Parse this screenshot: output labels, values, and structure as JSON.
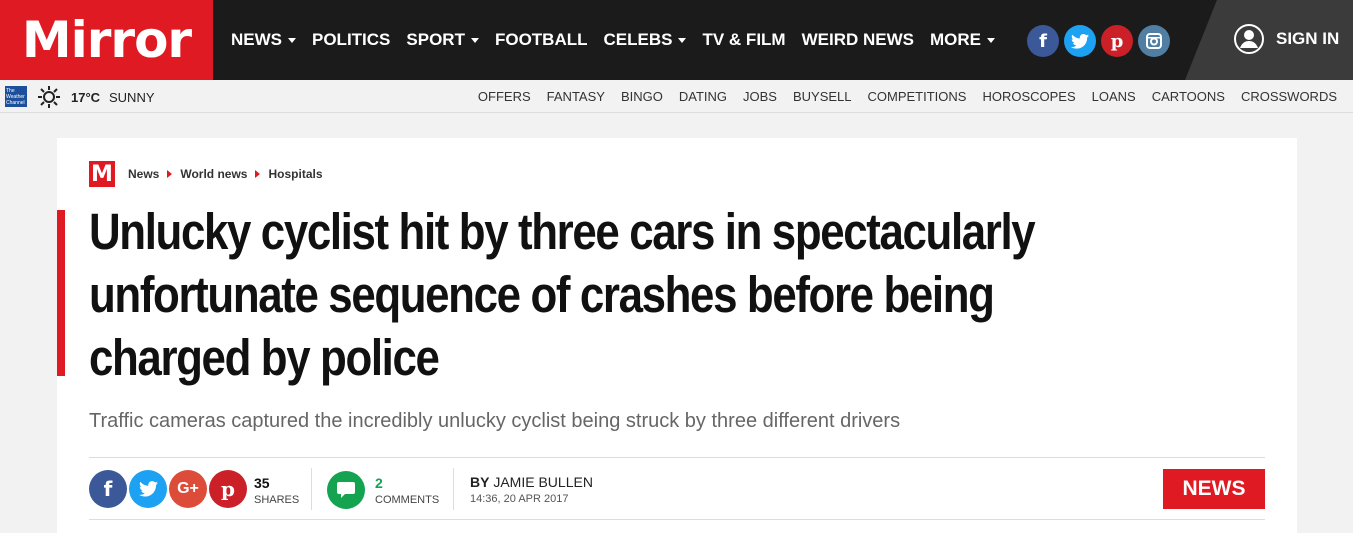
{
  "brand": {
    "logo_text": "Mirror"
  },
  "nav": {
    "items": [
      {
        "label": "NEWS",
        "dropdown": true
      },
      {
        "label": "POLITICS",
        "dropdown": false
      },
      {
        "label": "SPORT",
        "dropdown": true
      },
      {
        "label": "FOOTBALL",
        "dropdown": false
      },
      {
        "label": "CELEBS",
        "dropdown": true
      },
      {
        "label": "TV & FILM",
        "dropdown": false
      },
      {
        "label": "WEIRD NEWS",
        "dropdown": false
      },
      {
        "label": "MORE",
        "dropdown": true
      }
    ],
    "social": [
      {
        "icon": "facebook-icon",
        "glyph": "f",
        "color": "#3b5998"
      },
      {
        "icon": "twitter-icon",
        "glyph": "t",
        "color": "#1da1f2"
      },
      {
        "icon": "pinterest-icon",
        "glyph": "p",
        "color": "#cb2027"
      },
      {
        "icon": "instagram-icon",
        "glyph": "◘",
        "color": "#517fa4"
      }
    ],
    "sign_in": "SIGN IN"
  },
  "weather": {
    "provider_logo_text": "The Weather Channel",
    "temperature": "17°C",
    "condition": "SUNNY"
  },
  "sub_links": [
    "OFFERS",
    "FANTASY",
    "BINGO",
    "DATING",
    "JOBS",
    "BUYSELL",
    "COMPETITIONS",
    "HOROSCOPES",
    "LOANS",
    "CARTOONS",
    "CROSSWORDS"
  ],
  "article": {
    "breadcrumb_logo": "M",
    "breadcrumb": [
      "News",
      "World news",
      "Hospitals"
    ],
    "headline": "Unlucky cyclist hit by three cars in spectacularly unfortunate sequence of crashes before being charged by police",
    "standfirst": "Traffic cameras captured the incredibly unlucky cyclist being struck by three different drivers",
    "share_count": "35",
    "share_label": "SHARES",
    "comment_count": "2",
    "comment_label": "COMMENTS",
    "byline_prefix": "BY",
    "author": "JAMIE BULLEN",
    "timestamp": "14:36, 20 APR 2017",
    "section_tag": "NEWS"
  },
  "colors": {
    "brand_red": "#e01a22",
    "top_bar": "#1b1b1b",
    "comment_green": "#14a350",
    "gplus": "#dd4b39"
  }
}
